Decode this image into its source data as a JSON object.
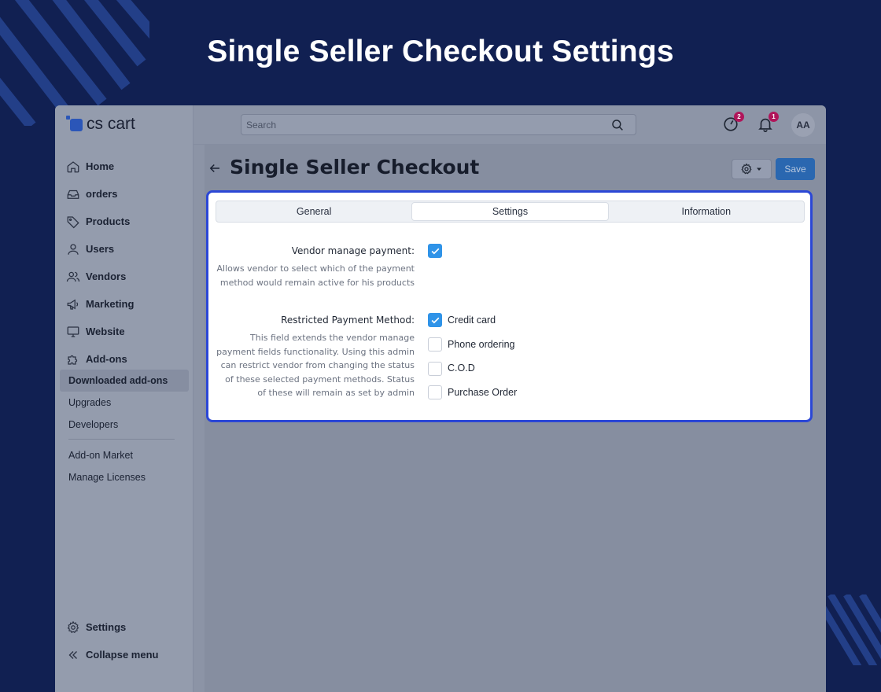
{
  "page_heading": "Single Seller Checkout Settings",
  "logo_text": "cs cart",
  "sidebar": {
    "items": [
      {
        "label": "Home",
        "icon": "home-icon"
      },
      {
        "label": "orders",
        "icon": "inbox-icon"
      },
      {
        "label": "Products",
        "icon": "tag-icon"
      },
      {
        "label": "Users",
        "icon": "user-icon"
      },
      {
        "label": "Vendors",
        "icon": "users-icon"
      },
      {
        "label": "Marketing",
        "icon": "megaphone-icon"
      },
      {
        "label": "Website",
        "icon": "monitor-icon"
      },
      {
        "label": "Add-ons",
        "icon": "puzzle-icon"
      }
    ],
    "sub_items": [
      {
        "label": "Downloaded add-ons",
        "active": true
      },
      {
        "label": "Upgrades"
      },
      {
        "label": "Developers"
      },
      {
        "label": "Add-on Market"
      },
      {
        "label": "Manage Licenses"
      }
    ],
    "settings_label": "Settings",
    "collapse_label": "Collapse menu"
  },
  "topbar": {
    "search_placeholder": "Search",
    "updates_badge": "2",
    "notifications_badge": "1",
    "avatar_initials": "AA"
  },
  "header": {
    "title": "Single Seller Checkout",
    "save_label": "Save"
  },
  "tabs": [
    {
      "label": "General"
    },
    {
      "label": "Settings",
      "active": true
    },
    {
      "label": "Information"
    }
  ],
  "settings": {
    "vendor_manage": {
      "label": "Vendor manage payment:",
      "desc_lines": [
        "Allows vendor to select which of the payment",
        "method would remain active for his products"
      ],
      "checked": true
    },
    "restricted": {
      "label": "Restricted Payment Method:",
      "desc_lines": [
        "This field extends the vendor manage",
        "payment fields functionality. Using this admin",
        "can restrict vendor from changing the status",
        "of these selected payment methods. Status",
        "of these will remain as set by admin"
      ],
      "options": [
        {
          "label": "Credit card",
          "checked": true
        },
        {
          "label": "Phone ordering",
          "checked": false
        },
        {
          "label": "C.O.D",
          "checked": false
        },
        {
          "label": "Purchase Order",
          "checked": false
        }
      ]
    }
  },
  "colors": {
    "background": "#112052",
    "accent": "#2b47d6",
    "checkbox": "#2f93e8",
    "badge": "#b0155a"
  }
}
